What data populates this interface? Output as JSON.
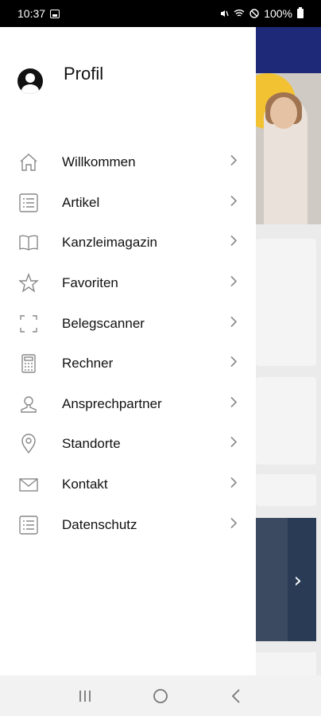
{
  "status_bar": {
    "time": "10:37",
    "battery": "100%"
  },
  "drawer": {
    "profile_label": "Profil",
    "items": [
      {
        "label": "Willkommen",
        "icon": "home-icon"
      },
      {
        "label": "Artikel",
        "icon": "list-icon"
      },
      {
        "label": "Kanzleimagazin",
        "icon": "book-icon"
      },
      {
        "label": "Favoriten",
        "icon": "star-icon"
      },
      {
        "label": "Belegscanner",
        "icon": "scan-icon"
      },
      {
        "label": "Rechner",
        "icon": "calculator-icon"
      },
      {
        "label": "Ansprechpartner",
        "icon": "person-icon"
      },
      {
        "label": "Standorte",
        "icon": "location-pin-icon"
      },
      {
        "label": "Kontakt",
        "icon": "mail-icon"
      },
      {
        "label": "Datenschutz",
        "icon": "document-icon"
      }
    ]
  },
  "colors": {
    "app_bar": "#1e2a78",
    "accent_yellow": "#f2c233"
  },
  "nav_bar": {
    "icons": [
      "recent-apps-icon",
      "home-circle-icon",
      "back-icon"
    ]
  }
}
